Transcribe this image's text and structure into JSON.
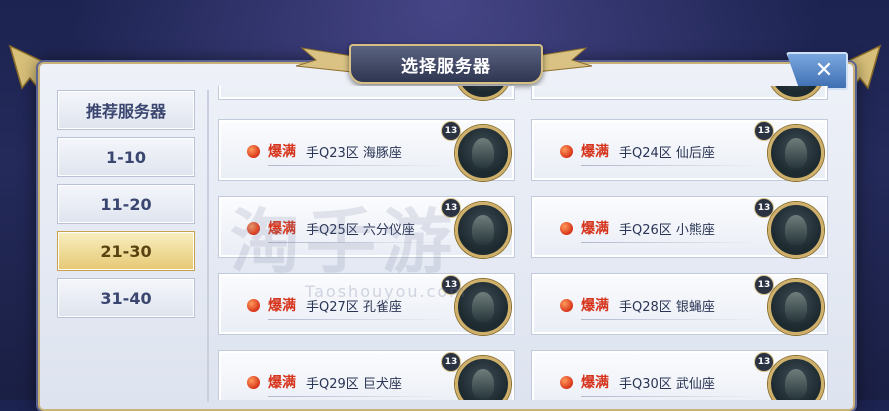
{
  "dialog": {
    "title": "选择服务器",
    "close_label": "✕"
  },
  "sidebar": {
    "items": [
      {
        "label": "推荐服务器",
        "active": false
      },
      {
        "label": "1-10",
        "active": false
      },
      {
        "label": "11-20",
        "active": false
      },
      {
        "label": "21-30",
        "active": true
      },
      {
        "label": "31-40",
        "active": false
      }
    ]
  },
  "servers": [
    {
      "status": "爆满",
      "name": "手Q23区 海豚座",
      "level": "13"
    },
    {
      "status": "爆满",
      "name": "手Q24区 仙后座",
      "level": "13"
    },
    {
      "status": "爆满",
      "name": "手Q25区 六分仪座",
      "level": "13"
    },
    {
      "status": "爆满",
      "name": "手Q26区 小熊座",
      "level": "13"
    },
    {
      "status": "爆满",
      "name": "手Q27区 孔雀座",
      "level": "13"
    },
    {
      "status": "爆满",
      "name": "手Q28区 银蝇座",
      "level": "13"
    },
    {
      "status": "爆满",
      "name": "手Q29区 巨犬座",
      "level": "13"
    },
    {
      "status": "爆满",
      "name": "手Q30区 武仙座",
      "level": "13"
    }
  ],
  "watermark": {
    "main": "淘手游",
    "sub": "Taoshouyou.com"
  },
  "colors": {
    "status_red": "#d6341c",
    "gold_border": "#d6bf83",
    "active_tab": "#e6c874"
  }
}
